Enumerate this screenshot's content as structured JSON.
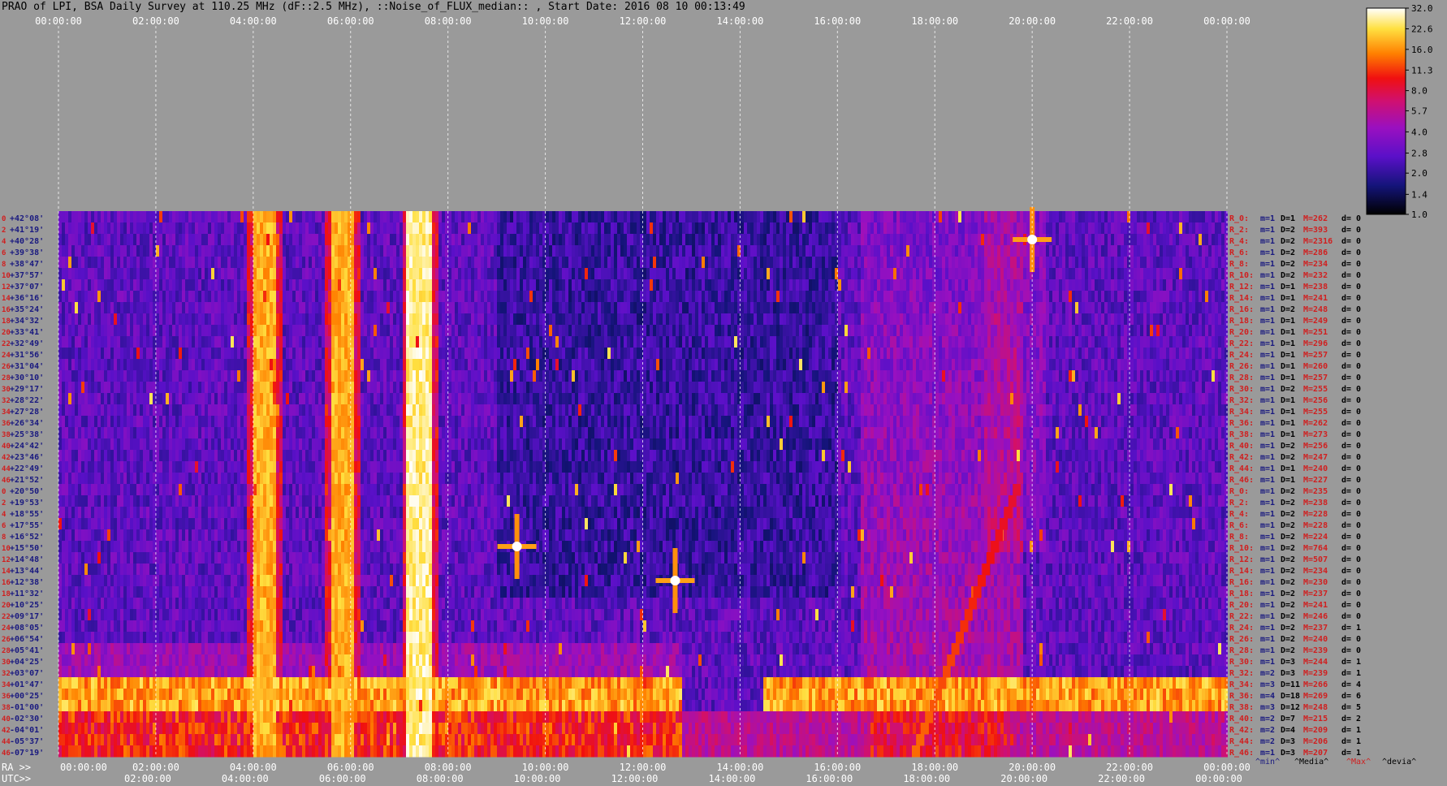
{
  "title": "PRAO of LPI, BSA Daily Survey at 110.25 MHz (dF::2.5 MHz), ::Noise_of_FLUX_median:: , Start Date: 2016 08 10 00:13:49",
  "chart_data": {
    "type": "heatmap",
    "title": "PRAO of LPI, BSA Daily Survey at 110.25 MHz (dF::2.5 MHz), ::Noise_of_FLUX_median:: , Start Date: 2016 08 10 00:13:49",
    "x_top_ticks": [
      "00:00:00",
      "02:00:00",
      "04:00:00",
      "06:00:00",
      "08:00:00",
      "10:00:00",
      "12:00:00",
      "14:00:00",
      "16:00:00",
      "18:00:00",
      "20:00:00",
      "22:00:00",
      "00:00:00"
    ],
    "ra_axis_label": "RA >>",
    "ra_ticks": [
      "00:00:00",
      "02:00:00",
      "04:00:00",
      "06:00:00",
      "08:00:00",
      "10:00:00",
      "12:00:00",
      "14:00:00",
      "16:00:00",
      "18:00:00",
      "20:00:00",
      "22:00:00",
      "00:00:00"
    ],
    "utc_axis_label": "UTC>>",
    "utc_ticks": [
      "02:00:00",
      "04:00:00",
      "06:00:00",
      "08:00:00",
      "10:00:00",
      "12:00:00",
      "14:00:00",
      "16:00:00",
      "18:00:00",
      "20:00:00",
      "22:00:00",
      "00:00:00"
    ],
    "row_numbers": [
      "0",
      "2",
      "4",
      "6",
      "8",
      "10",
      "12",
      "14",
      "16",
      "18",
      "20",
      "22",
      "24",
      "26",
      "28",
      "30",
      "32",
      "34",
      "36",
      "38",
      "40",
      "42",
      "44",
      "46",
      "0",
      "2",
      "4",
      "6",
      "8",
      "10",
      "12",
      "14",
      "16",
      "18",
      "20",
      "22",
      "24",
      "26",
      "28",
      "30",
      "32",
      "34",
      "36",
      "38",
      "40",
      "42",
      "44",
      "46"
    ],
    "declinations": [
      "+42°08'",
      "+41°19'",
      "+40°28'",
      "+39°38'",
      "+38°47'",
      "+37°57'",
      "+37°07'",
      "+36°16'",
      "+35°24'",
      "+34°32'",
      "+33°41'",
      "+32°49'",
      "+31°56'",
      "+31°04'",
      "+30°10'",
      "+29°17'",
      "+28°22'",
      "+27°28'",
      "+26°34'",
      "+25°38'",
      "+24°42'",
      "+23°46'",
      "+22°49'",
      "+21°52'",
      "+20°50'",
      "+19°53'",
      "+18°55'",
      "+17°55'",
      "+16°52'",
      "+15°50'",
      "+14°48'",
      "+13°44'",
      "+12°38'",
      "+11°32'",
      "+10°25'",
      "+09°17'",
      "+08°05'",
      "+06°54'",
      "+05°41'",
      "+04°25'",
      "+03°07'",
      "+01°47'",
      "+00°25'",
      "-01°00'",
      "-02°30'",
      "-04°01'",
      "-05°37'",
      "-07°19'"
    ],
    "right_stats": [
      {
        "r": "R_0:",
        "m": "m=1",
        "D": "D=1",
        "M": "M=262",
        "d": "d= 0"
      },
      {
        "r": "R_2:",
        "m": "m=1",
        "D": "D=2",
        "M": "M=393",
        "d": "d= 0"
      },
      {
        "r": "R_4:",
        "m": "m=1",
        "D": "D=2",
        "M": "M=2316",
        "d": "d= 0"
      },
      {
        "r": "R_6:",
        "m": "m=1",
        "D": "D=2",
        "M": "M=286",
        "d": "d= 0"
      },
      {
        "r": "R_8:",
        "m": "m=1",
        "D": "D=2",
        "M": "M=234",
        "d": "d= 0"
      },
      {
        "r": "R_10:",
        "m": "m=1",
        "D": "D=2",
        "M": "M=232",
        "d": "d= 0"
      },
      {
        "r": "R_12:",
        "m": "m=1",
        "D": "D=1",
        "M": "M=238",
        "d": "d= 0"
      },
      {
        "r": "R_14:",
        "m": "m=1",
        "D": "D=1",
        "M": "M=241",
        "d": "d= 0"
      },
      {
        "r": "R_16:",
        "m": "m=1",
        "D": "D=2",
        "M": "M=248",
        "d": "d= 0"
      },
      {
        "r": "R_18:",
        "m": "m=1",
        "D": "D=1",
        "M": "M=249",
        "d": "d= 0"
      },
      {
        "r": "R_20:",
        "m": "m=1",
        "D": "D=1",
        "M": "M=251",
        "d": "d= 0"
      },
      {
        "r": "R_22:",
        "m": "m=1",
        "D": "D=1",
        "M": "M=296",
        "d": "d= 0"
      },
      {
        "r": "R_24:",
        "m": "m=1",
        "D": "D=1",
        "M": "M=257",
        "d": "d= 0"
      },
      {
        "r": "R_26:",
        "m": "m=1",
        "D": "D=1",
        "M": "M=260",
        "d": "d= 0"
      },
      {
        "r": "R_28:",
        "m": "m=1",
        "D": "D=1",
        "M": "M=257",
        "d": "d= 0"
      },
      {
        "r": "R_30:",
        "m": "m=1",
        "D": "D=2",
        "M": "M=255",
        "d": "d= 0"
      },
      {
        "r": "R_32:",
        "m": "m=1",
        "D": "D=1",
        "M": "M=256",
        "d": "d= 0"
      },
      {
        "r": "R_34:",
        "m": "m=1",
        "D": "D=1",
        "M": "M=255",
        "d": "d= 0"
      },
      {
        "r": "R_36:",
        "m": "m=1",
        "D": "D=1",
        "M": "M=262",
        "d": "d= 0"
      },
      {
        "r": "R_38:",
        "m": "m=1",
        "D": "D=1",
        "M": "M=273",
        "d": "d= 0"
      },
      {
        "r": "R_40:",
        "m": "m=1",
        "D": "D=2",
        "M": "M=256",
        "d": "d= 0"
      },
      {
        "r": "R_42:",
        "m": "m=1",
        "D": "D=2",
        "M": "M=247",
        "d": "d= 0"
      },
      {
        "r": "R_44:",
        "m": "m=1",
        "D": "D=1",
        "M": "M=240",
        "d": "d= 0"
      },
      {
        "r": "R_46:",
        "m": "m=1",
        "D": "D=1",
        "M": "M=227",
        "d": "d= 0"
      },
      {
        "r": "R_0:",
        "m": "m=1",
        "D": "D=2",
        "M": "M=235",
        "d": "d= 0"
      },
      {
        "r": "R_2:",
        "m": "m=1",
        "D": "D=2",
        "M": "M=238",
        "d": "d= 0"
      },
      {
        "r": "R_4:",
        "m": "m=1",
        "D": "D=2",
        "M": "M=228",
        "d": "d= 0"
      },
      {
        "r": "R_6:",
        "m": "m=1",
        "D": "D=2",
        "M": "M=228",
        "d": "d= 0"
      },
      {
        "r": "R_8:",
        "m": "m=1",
        "D": "D=2",
        "M": "M=224",
        "d": "d= 0"
      },
      {
        "r": "R_10:",
        "m": "m=1",
        "D": "D=2",
        "M": "M=764",
        "d": "d= 0"
      },
      {
        "r": "R_12:",
        "m": "m=1",
        "D": "D=2",
        "M": "M=507",
        "d": "d= 0"
      },
      {
        "r": "R_14:",
        "m": "m=1",
        "D": "D=2",
        "M": "M=234",
        "d": "d= 0"
      },
      {
        "r": "R_16:",
        "m": "m=1",
        "D": "D=2",
        "M": "M=230",
        "d": "d= 0"
      },
      {
        "r": "R_18:",
        "m": "m=1",
        "D": "D=2",
        "M": "M=237",
        "d": "d= 0"
      },
      {
        "r": "R_20:",
        "m": "m=1",
        "D": "D=2",
        "M": "M=241",
        "d": "d= 0"
      },
      {
        "r": "R_22:",
        "m": "m=1",
        "D": "D=2",
        "M": "M=246",
        "d": "d= 0"
      },
      {
        "r": "R_24:",
        "m": "m=1",
        "D": "D=2",
        "M": "M=237",
        "d": "d= 1"
      },
      {
        "r": "R_26:",
        "m": "m=1",
        "D": "D=2",
        "M": "M=240",
        "d": "d= 0"
      },
      {
        "r": "R_28:",
        "m": "m=1",
        "D": "D=2",
        "M": "M=239",
        "d": "d= 0"
      },
      {
        "r": "R_30:",
        "m": "m=1",
        "D": "D=3",
        "M": "M=244",
        "d": "d= 1"
      },
      {
        "r": "R_32:",
        "m": "m=2",
        "D": "D=3",
        "M": "M=239",
        "d": "d= 1"
      },
      {
        "r": "R_34:",
        "m": "m=3",
        "D": "D=11",
        "M": "M=266",
        "d": "d= 4"
      },
      {
        "r": "R_36:",
        "m": "m=4",
        "D": "D=18",
        "M": "M=269",
        "d": "d= 6"
      },
      {
        "r": "R_38:",
        "m": "m=3",
        "D": "D=12",
        "M": "M=248",
        "d": "d= 5"
      },
      {
        "r": "R_40:",
        "m": "m=2",
        "D": "D=7",
        "M": "M=215",
        "d": "d= 2"
      },
      {
        "r": "R_42:",
        "m": "m=2",
        "D": "D=4",
        "M": "M=209",
        "d": "d= 1"
      },
      {
        "r": "R_44:",
        "m": "m=2",
        "D": "D=3",
        "M": "M=206",
        "d": "d= 1"
      },
      {
        "r": "R_46:",
        "m": "m=1",
        "D": "D=3",
        "M": "M=207",
        "d": "d= 1"
      }
    ],
    "stat_legend": [
      "^min^",
      "^Media^",
      "^Max^",
      "^devia^"
    ],
    "colorbar_ticks": [
      "32.0",
      "22.6",
      "16.0",
      "11.3",
      "8.0",
      "5.7",
      "4.0",
      "2.8",
      "2.0",
      "1.4",
      "1.0"
    ],
    "colorbar_range": [
      1.0,
      32.0
    ],
    "colorbar_scale": "log",
    "features": [
      {
        "kind": "vertical_band",
        "utc": "04:15",
        "intensity": "high"
      },
      {
        "kind": "vertical_band",
        "utc": "05:50",
        "intensity": "high"
      },
      {
        "kind": "vertical_band",
        "utc": "07:25",
        "intensity": "very high"
      },
      {
        "kind": "horizontal_band",
        "declination": "+00°25'",
        "intensity": "high"
      },
      {
        "kind": "point_source",
        "utc": "09:25",
        "declination": "+15°50'"
      },
      {
        "kind": "point_source",
        "utc": "20:00",
        "declination": "+40°28'"
      },
      {
        "kind": "point_source",
        "utc": "12:40",
        "declination": "+12°38'"
      }
    ],
    "colors": {
      "background": "#9a9a9a",
      "plot_background": "#2a1a6a",
      "grid": "#ffffff",
      "row_number": "#d02020",
      "declination": "#1a1a80",
      "stat_r": "#d02020",
      "stat_m": "#1a1a80",
      "stat_D": "#000000",
      "stat_M": "#d02020",
      "stat_d": "#000000"
    }
  }
}
